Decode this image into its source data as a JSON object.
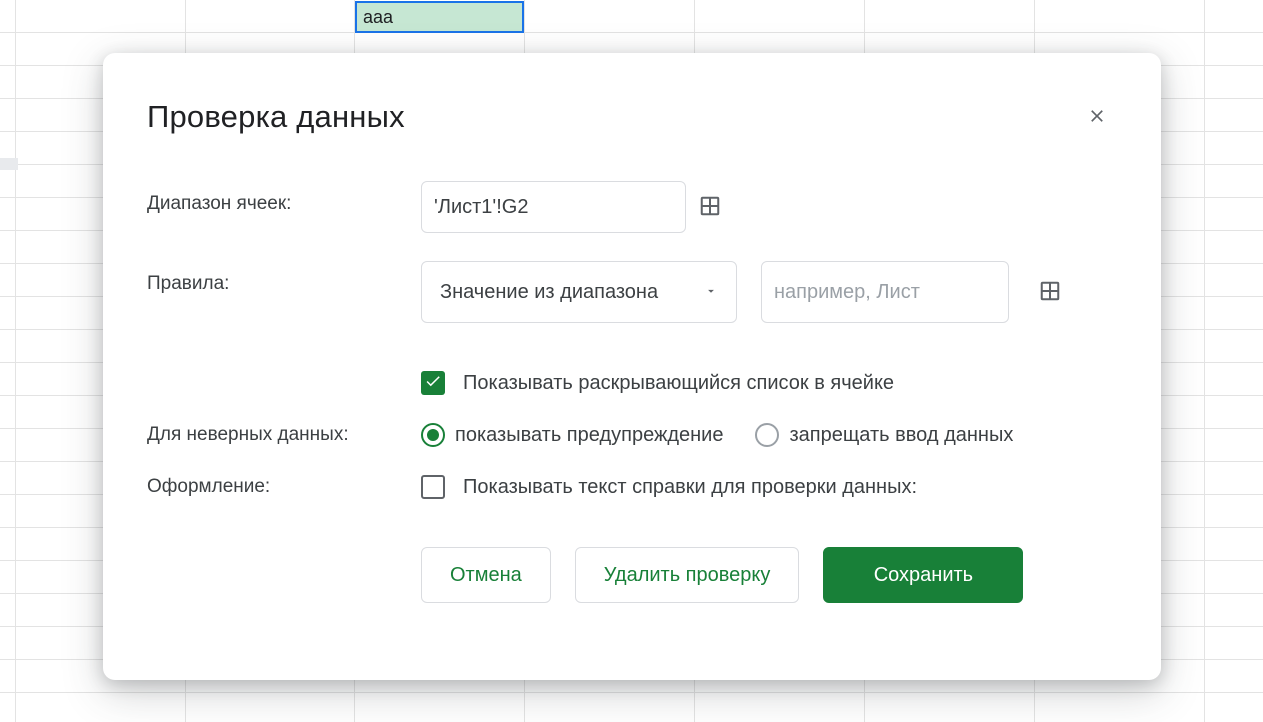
{
  "cell": {
    "value": "aaa"
  },
  "dialog": {
    "title": "Проверка данных",
    "labels": {
      "cell_range": "Диапазон ячеек:",
      "rules": "Правила:",
      "on_invalid": "Для неверных данных:",
      "appearance": "Оформление:"
    },
    "cell_range_value": "'Лист1'!G2",
    "rule": {
      "selected": "Значение из диапазона",
      "source_value": "",
      "source_placeholder": "например, Лист"
    },
    "show_dropdown_label": "Показывать раскрывающийся список в ячейке",
    "invalid": {
      "warn": "показывать предупреждение",
      "reject": "запрещать ввод данных"
    },
    "help_text_label": "Показывать текст справки для проверки данных:",
    "buttons": {
      "cancel": "Отмена",
      "remove": "Удалить проверку",
      "save": "Сохранить"
    }
  },
  "colors": {
    "accent": "#188038",
    "blue": "#1a73e8"
  }
}
